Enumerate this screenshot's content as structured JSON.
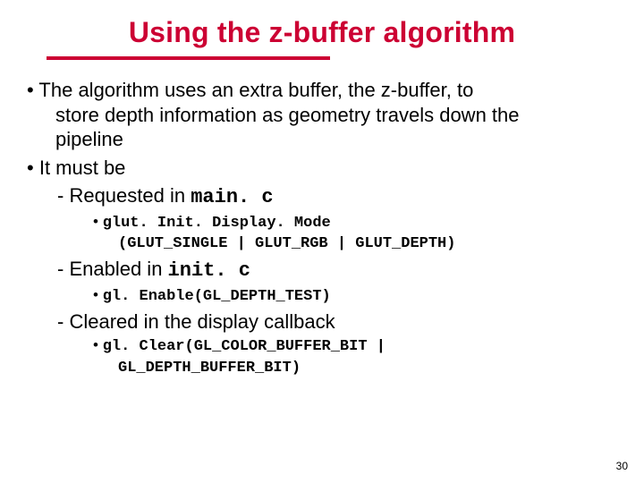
{
  "title": "Using the z-buffer algorithm",
  "bullets": {
    "b1_line1": "The algorithm uses an extra buffer, the z-buffer, to",
    "b1_line2": "store depth information as geometry travels down the",
    "b1_line3": "pipeline",
    "b2": "It must be",
    "s1_prefix": "Requested in ",
    "s1_code": "main. c",
    "s1_sub_line1": "glut. Init. Display. Mode",
    "s1_sub_line2": "(GLUT_SINGLE | GLUT_RGB | GLUT_DEPTH)",
    "s2_prefix": "Enabled in ",
    "s2_code": "init. c",
    "s2_sub": "gl. Enable(GL_DEPTH_TEST)",
    "s3": "Cleared in the display callback",
    "s3_sub_line1": "gl. Clear(GL_COLOR_BUFFER_BIT |",
    "s3_sub_line2": "GL_DEPTH_BUFFER_BIT)"
  },
  "page_number": "30"
}
